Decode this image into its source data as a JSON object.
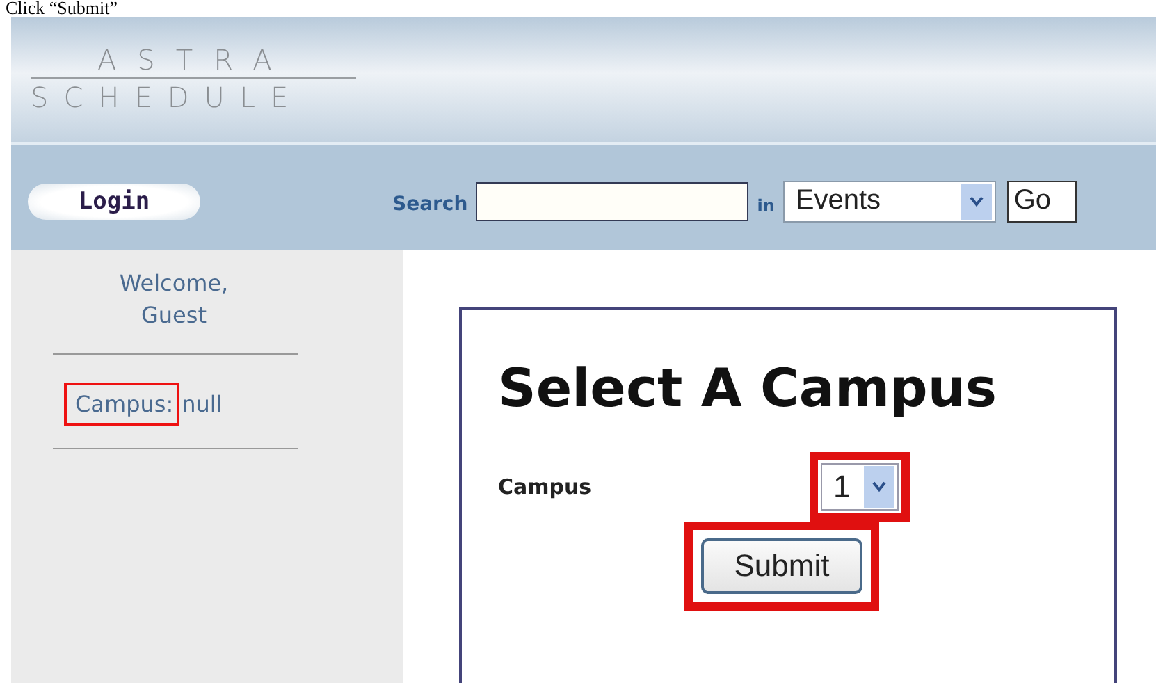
{
  "caption": "Click “Submit”",
  "logo": {
    "line_1": "ASTRA",
    "line_2": "SCHEDULE"
  },
  "nav": {
    "login": "Login",
    "search_label": "Search",
    "in_label": "in",
    "scope": "Events",
    "go": "Go"
  },
  "sidebar": {
    "welcome": "Welcome, Guest",
    "campus_label": "Campus:",
    "campus_value": "null",
    "campus_highlighted": true
  },
  "form": {
    "title": "Select A Campus",
    "field_label": "Campus",
    "campus_value": "1",
    "select_highlighted": true,
    "submit": "Submit",
    "submit_highlighted": true
  }
}
